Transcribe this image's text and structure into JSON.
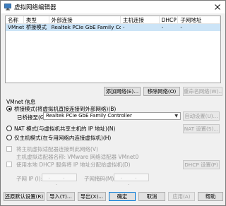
{
  "window": {
    "title": "虚拟网络编辑器"
  },
  "table": {
    "columns": [
      "名称",
      "类型",
      "外部连接",
      "主机连接",
      "DHCP",
      "子网地址"
    ],
    "rows": [
      [
        "VMnet0",
        "桥接模式",
        "Realtek PCIe GbE Family Contr...",
        "-",
        "-",
        "-"
      ]
    ]
  },
  "network_buttons": {
    "add": "添加网络(E)...",
    "remove": "移除网络(O)",
    "rename": "重命名网络(W)..."
  },
  "vmnet_info": {
    "heading": "VMnet 信息",
    "bridge_mode": "桥接模式(将虚拟机直接连接到外部网络)(B)",
    "bridged_to_label": "已桥接至(G):",
    "bridged_to_value": "Realtek PCIe GbE Family Controller",
    "auto_settings": "自动设置(U)...",
    "nat_mode": "NAT 模式(与虚拟机共享主机的 IP 地址)(N)",
    "nat_settings": "NAT 设置(S)...",
    "host_only_mode": "仅主机模式(在专用网络内连接虚拟机)(H)",
    "connect_adapter": "将主机虚拟适配器连接到此网络(V)",
    "adapter_name": "主机虚拟适配器名称: VMware 网络适配器 VMnet0",
    "use_dhcp": "使用本地 DHCP 服务将 IP 地址分配给虚拟机(D)",
    "dhcp_settings": "DHCP 设置(P)",
    "subnet_ip_label": "子网 IP (I):",
    "subnet_ip_value": ". . .",
    "subnet_mask_label": "子网掩码(M):",
    "subnet_mask_value": ". . ."
  },
  "footer_buttons": {
    "restore": "还原默认设置(R)",
    "import": "导入(T)...",
    "export": "导出(X)...",
    "ok": "确定",
    "cancel": "取消",
    "apply": "应用(A)",
    "help": "帮助"
  }
}
